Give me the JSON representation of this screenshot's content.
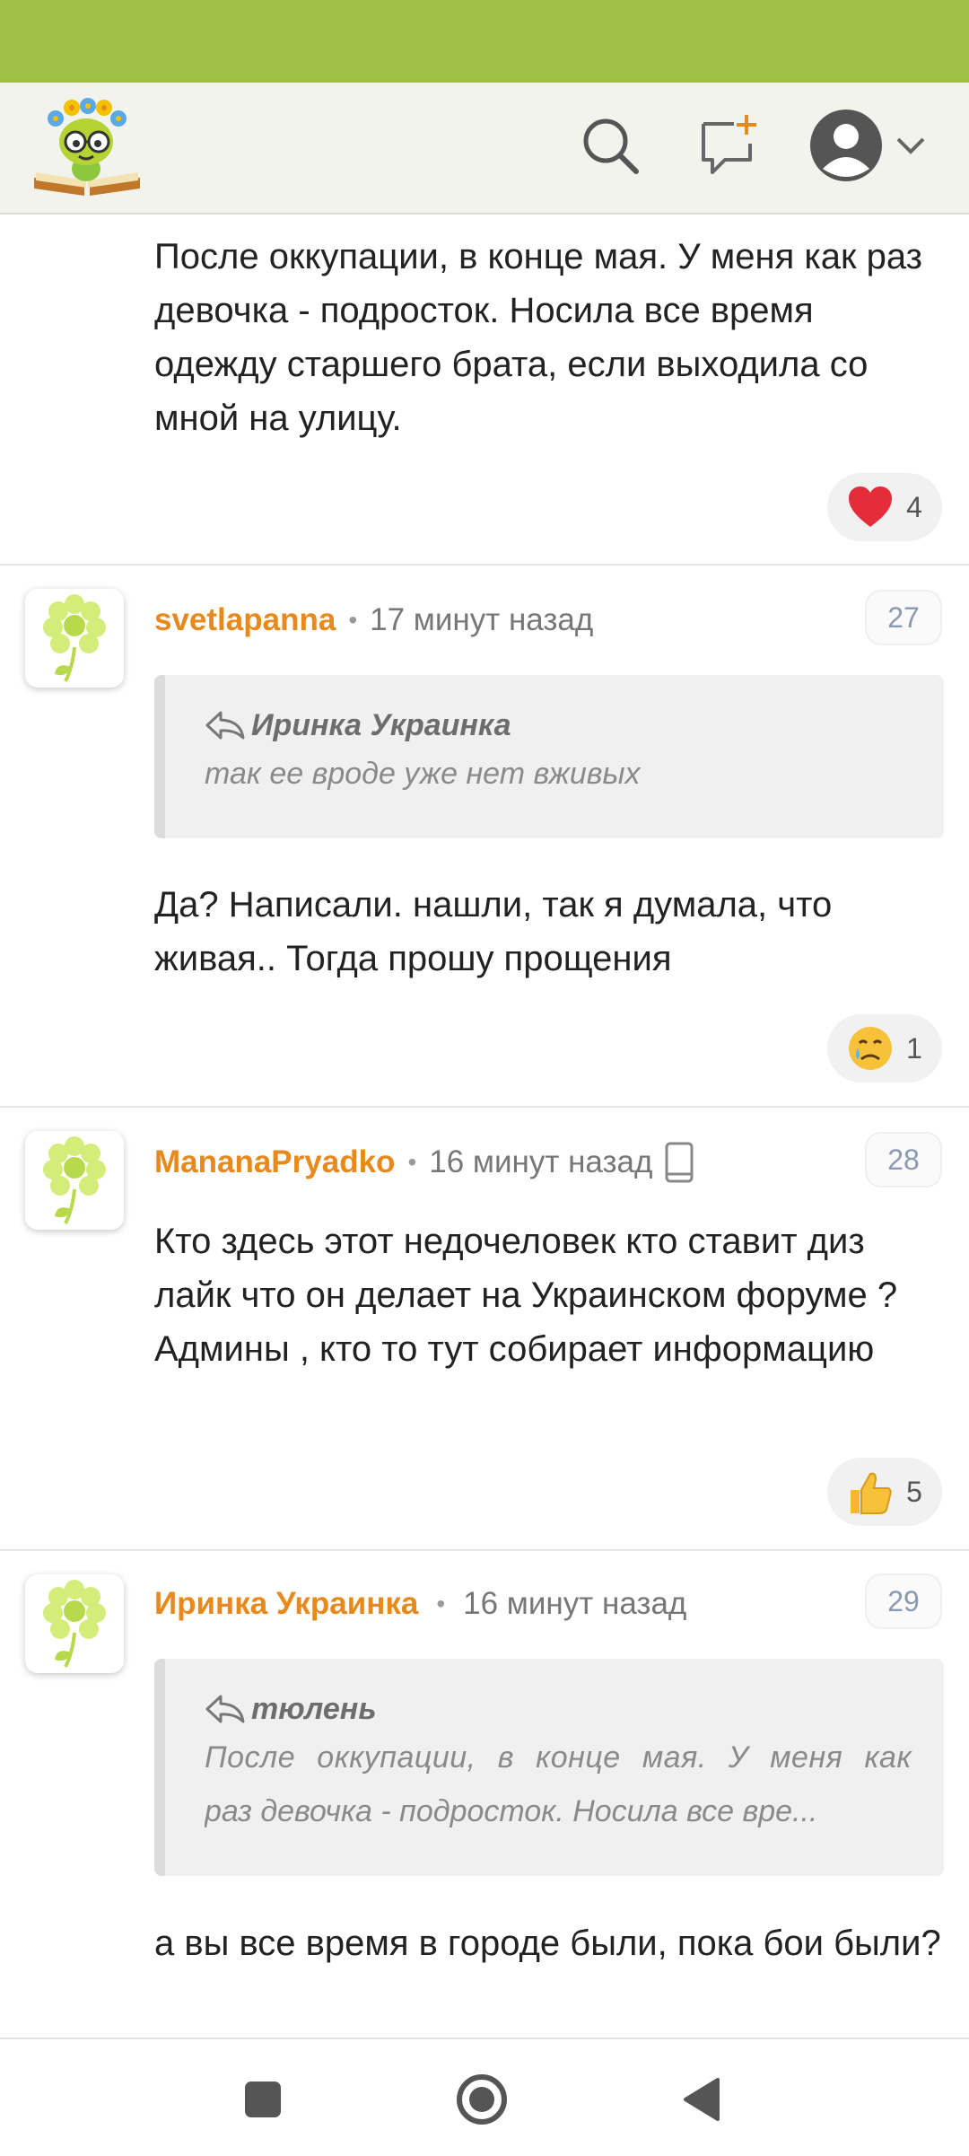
{
  "header": {
    "logo": "smiley-bookworm-logo",
    "icons": [
      "search-icon",
      "new-post-icon",
      "profile-icon",
      "chevron-down-icon"
    ]
  },
  "top_comment": {
    "text": "После оккупации, в конце мая. У меня как раз девочка - подросток. Носила все время одежду старшего брата, если выходила со мной на улицу.",
    "reaction": {
      "icon": "heart-emoji",
      "count": "4"
    }
  },
  "comments": [
    {
      "author": "svetlapanna",
      "time": "17 минут назад",
      "number": "27",
      "quote": {
        "author": "Иринка Украинка",
        "text": "так ее вроде уже нет вживых"
      },
      "text": "Да? Написали. нашли, так я думала, что живая.. Тогда прошу прощения",
      "reaction": {
        "icon": "crying-face-emoji",
        "count": "1"
      }
    },
    {
      "author": "MananaPryadko",
      "time": "16 минут назад",
      "number": "28",
      "device_icon": "mobile-phone-icon",
      "text": "Кто здесь этот недочеловек кто ставит диз лайк что он делает на Украинском форуме ? Админы , кто то тут собирает информацию",
      "reaction": {
        "icon": "thumbs-up-emoji",
        "count": "5"
      }
    },
    {
      "author": "Иринка Украинка",
      "time": "16 минут назад",
      "number": "29",
      "quote": {
        "author": "тюлень",
        "line1": "После оккупации, в конце мая. У меня как",
        "line2": "раз девочка - подросток. Носила все вре..."
      },
      "text": "а вы все время в городе были, пока бои были?"
    }
  ],
  "colors": {
    "status_bar": "#9ec045",
    "author": "#e8891c",
    "header_bg": "#f3f3ee"
  },
  "nav": [
    "recent-apps-button",
    "home-button",
    "back-button"
  ]
}
